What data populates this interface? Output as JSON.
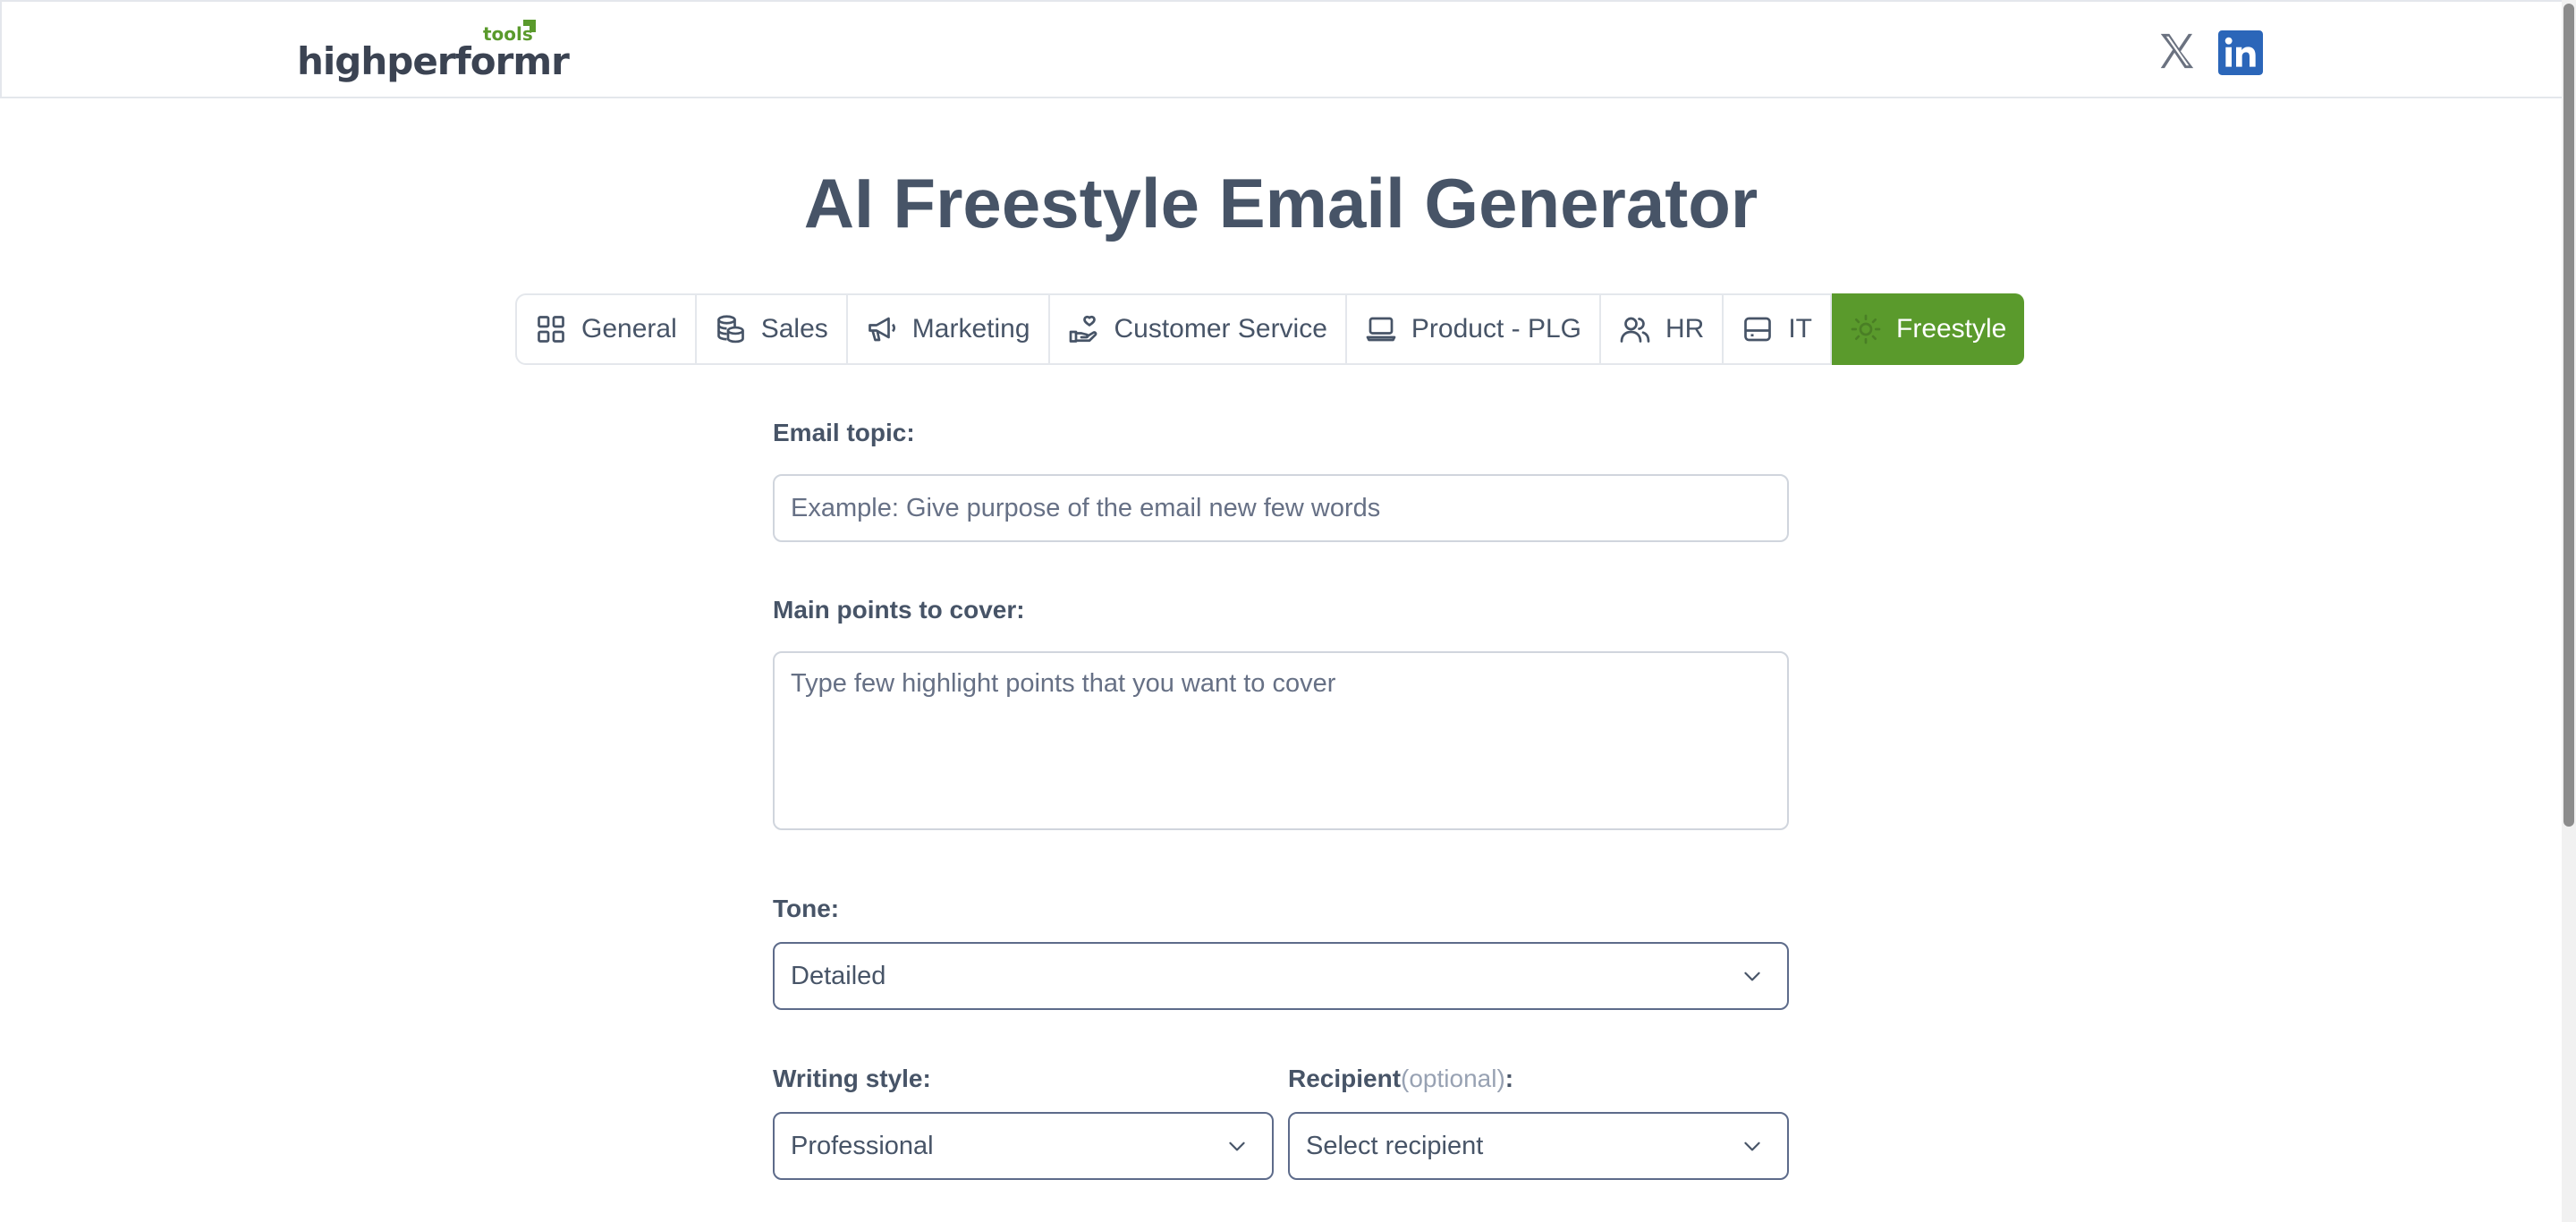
{
  "brand": {
    "logo_text": "highperformr",
    "logo_tag": "tools",
    "accent_color": "#5a9a2c"
  },
  "header": {
    "social": [
      {
        "name": "x-icon"
      },
      {
        "name": "linkedin-icon",
        "color": "#2b66b9"
      }
    ]
  },
  "page": {
    "title": "AI Freestyle Email Generator"
  },
  "tabs": [
    {
      "label": "General",
      "icon": "grid-icon"
    },
    {
      "label": "Sales",
      "icon": "coins-icon"
    },
    {
      "label": "Marketing",
      "icon": "megaphone-icon"
    },
    {
      "label": "Customer Service",
      "icon": "hand-heart-icon"
    },
    {
      "label": "Product - PLG",
      "icon": "laptop-icon"
    },
    {
      "label": "HR",
      "icon": "users-icon"
    },
    {
      "label": "IT",
      "icon": "hard-drive-icon"
    },
    {
      "label": "Freestyle",
      "icon": "sun-icon",
      "active": true
    }
  ],
  "form": {
    "email_topic": {
      "label": "Email topic:",
      "placeholder": "Example: Give purpose of the email new few words",
      "value": ""
    },
    "main_points": {
      "label": "Main points to cover:",
      "placeholder": "Type few highlight points that you want to cover",
      "value": ""
    },
    "tone": {
      "label": "Tone:",
      "value": "Detailed"
    },
    "writing_style": {
      "label": "Writing style:",
      "value": "Professional"
    },
    "recipient": {
      "label": "Recipient",
      "label_optional": "(optional)",
      "label_suffix": ":",
      "value": "Select recipient"
    }
  }
}
